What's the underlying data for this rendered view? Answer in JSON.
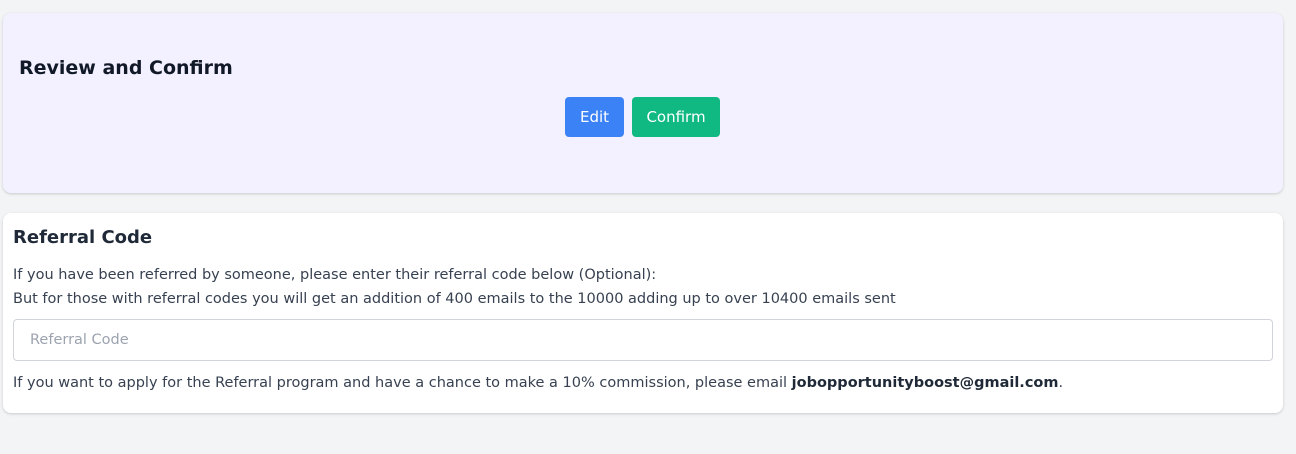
{
  "review": {
    "title": "Review and Confirm",
    "edit_label": "Edit",
    "confirm_label": "Confirm"
  },
  "referral": {
    "title": "Referral Code",
    "line1": "If you have been referred by someone, please enter their referral code below (Optional):",
    "line2": "But for those with referral codes you will get an addition of 400 emails to the 10000 adding up to over 10400 emails sent",
    "input_value": "",
    "input_placeholder": "Referral Code",
    "footnote_prefix": "If you want to apply for the Referral program and have a chance to make a 10% commission, please email ",
    "footnote_email": "jobopportunityboost@gmail.com",
    "footnote_suffix": "."
  },
  "colors": {
    "edit_button": "#3b82f6",
    "confirm_button": "#10b981",
    "review_card_bg": "#f3f1ff",
    "page_bg": "#f3f4f6"
  }
}
